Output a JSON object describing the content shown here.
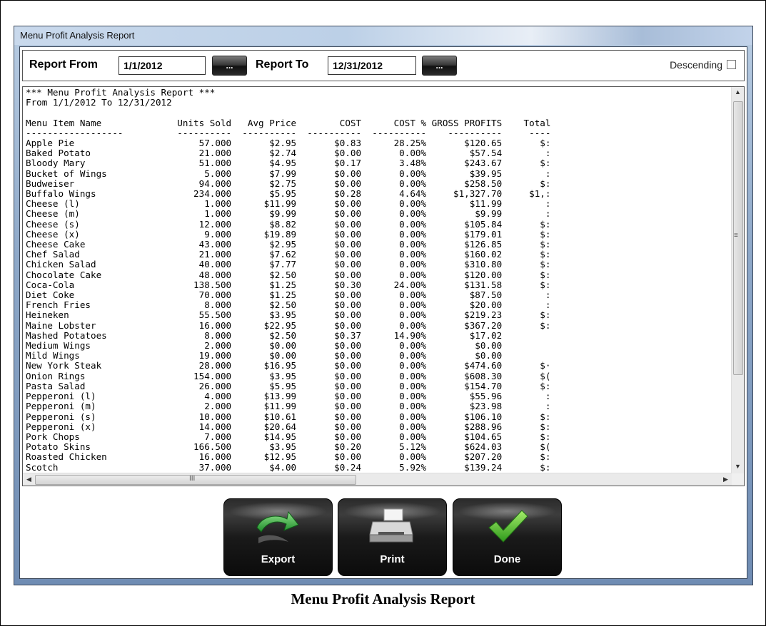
{
  "window": {
    "title": "Menu Profit Analysis Report"
  },
  "filters": {
    "report_from_label": "Report From",
    "report_from_value": "1/1/2012",
    "report_to_label": "Report To",
    "report_to_value": "12/31/2012",
    "browse_label": "...",
    "descending_label": "Descending",
    "descending_checked": false
  },
  "report": {
    "title_line": "*** Menu Profit Analysis Report ***",
    "range_line": "From 1/1/2012 To 12/31/2012",
    "columns": [
      "Menu Item Name",
      "Units Sold",
      "Avg Price",
      "COST",
      "COST %",
      "GROSS PROFITS",
      "Total"
    ],
    "rows": [
      [
        "Apple Pie",
        "57.000",
        "$2.95",
        "$0.83",
        "28.25%",
        "$120.65",
        "$:"
      ],
      [
        "Baked Potato",
        "21.000",
        "$2.74",
        "$0.00",
        "0.00%",
        "$57.54",
        ":"
      ],
      [
        "Bloody Mary",
        "51.000",
        "$4.95",
        "$0.17",
        "3.48%",
        "$243.67",
        "$:"
      ],
      [
        "Bucket of Wings",
        "5.000",
        "$7.99",
        "$0.00",
        "0.00%",
        "$39.95",
        ":"
      ],
      [
        "Budweiser",
        "94.000",
        "$2.75",
        "$0.00",
        "0.00%",
        "$258.50",
        "$:"
      ],
      [
        "Buffalo Wings",
        "234.000",
        "$5.95",
        "$0.28",
        "4.64%",
        "$1,327.70",
        "$1,:"
      ],
      [
        "Cheese (l)",
        "1.000",
        "$11.99",
        "$0.00",
        "0.00%",
        "$11.99",
        ":"
      ],
      [
        "Cheese (m)",
        "1.000",
        "$9.99",
        "$0.00",
        "0.00%",
        "$9.99",
        ":"
      ],
      [
        "Cheese (s)",
        "12.000",
        "$8.82",
        "$0.00",
        "0.00%",
        "$105.84",
        "$:"
      ],
      [
        "Cheese (x)",
        "9.000",
        "$19.89",
        "$0.00",
        "0.00%",
        "$179.01",
        "$:"
      ],
      [
        "Cheese Cake",
        "43.000",
        "$2.95",
        "$0.00",
        "0.00%",
        "$126.85",
        "$:"
      ],
      [
        "Chef Salad",
        "21.000",
        "$7.62",
        "$0.00",
        "0.00%",
        "$160.02",
        "$:"
      ],
      [
        "Chicken Salad",
        "40.000",
        "$7.77",
        "$0.00",
        "0.00%",
        "$310.80",
        "$:"
      ],
      [
        "Chocolate Cake",
        "48.000",
        "$2.50",
        "$0.00",
        "0.00%",
        "$120.00",
        "$:"
      ],
      [
        "Coca-Cola",
        "138.500",
        "$1.25",
        "$0.30",
        "24.00%",
        "$131.58",
        "$:"
      ],
      [
        "Diet Coke",
        "70.000",
        "$1.25",
        "$0.00",
        "0.00%",
        "$87.50",
        ":"
      ],
      [
        "French Fries",
        "8.000",
        "$2.50",
        "$0.00",
        "0.00%",
        "$20.00",
        ":"
      ],
      [
        "Heineken",
        "55.500",
        "$3.95",
        "$0.00",
        "0.00%",
        "$219.23",
        "$:"
      ],
      [
        "Maine Lobster",
        "16.000",
        "$22.95",
        "$0.00",
        "0.00%",
        "$367.20",
        "$:"
      ],
      [
        "Mashed Potatoes",
        "8.000",
        "$2.50",
        "$0.37",
        "14.90%",
        "$17.02",
        ""
      ],
      [
        "Medium Wings",
        "2.000",
        "$0.00",
        "$0.00",
        "0.00%",
        "$0.00",
        ""
      ],
      [
        "Mild Wings",
        "19.000",
        "$0.00",
        "$0.00",
        "0.00%",
        "$0.00",
        ""
      ],
      [
        "New York Steak",
        "28.000",
        "$16.95",
        "$0.00",
        "0.00%",
        "$474.60",
        "$·"
      ],
      [
        "Onion Rings",
        "154.000",
        "$3.95",
        "$0.00",
        "0.00%",
        "$608.30",
        "$("
      ],
      [
        "Pasta Salad",
        "26.000",
        "$5.95",
        "$0.00",
        "0.00%",
        "$154.70",
        "$:"
      ],
      [
        "Pepperoni (l)",
        "4.000",
        "$13.99",
        "$0.00",
        "0.00%",
        "$55.96",
        ":"
      ],
      [
        "Pepperoni (m)",
        "2.000",
        "$11.99",
        "$0.00",
        "0.00%",
        "$23.98",
        ":"
      ],
      [
        "Pepperoni (s)",
        "10.000",
        "$10.61",
        "$0.00",
        "0.00%",
        "$106.10",
        "$:"
      ],
      [
        "Pepperoni (x)",
        "14.000",
        "$20.64",
        "$0.00",
        "0.00%",
        "$288.96",
        "$:"
      ],
      [
        "Pork Chops",
        "7.000",
        "$14.95",
        "$0.00",
        "0.00%",
        "$104.65",
        "$:"
      ],
      [
        "Potato Skins",
        "166.500",
        "$3.95",
        "$0.20",
        "5.12%",
        "$624.03",
        "$("
      ],
      [
        "Roasted Chicken",
        "16.000",
        "$12.95",
        "$0.00",
        "0.00%",
        "$207.20",
        "$:"
      ],
      [
        "Scotch",
        "37.000",
        "$4.00",
        "$0.24",
        "5.92%",
        "$139.24",
        "$:"
      ]
    ]
  },
  "actions": {
    "export_label": "Export",
    "print_label": "Print",
    "done_label": "Done"
  },
  "caption": "Menu Profit Analysis Report"
}
